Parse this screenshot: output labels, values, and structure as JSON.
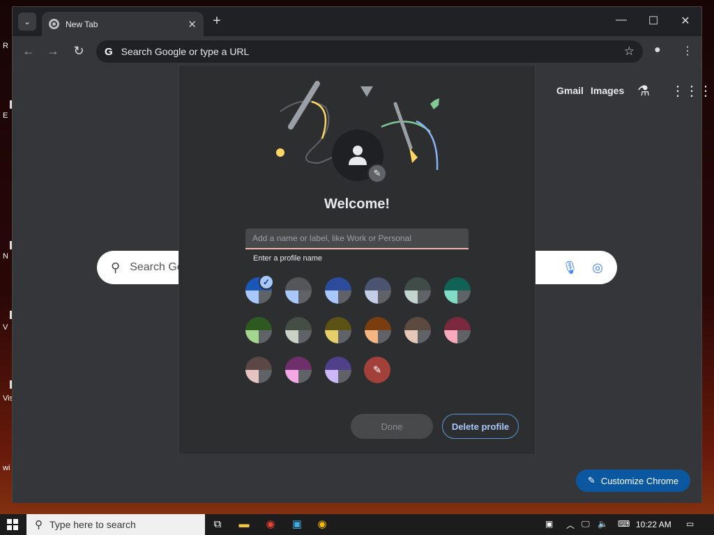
{
  "desktop": {
    "labels": [
      "R",
      "E",
      "N",
      "V",
      "Vis",
      "wi"
    ]
  },
  "browser": {
    "tab_title": "New Tab",
    "omnibox_placeholder": "Search Google or type a URL",
    "ntp": {
      "gmail": "Gmail",
      "images": "Images",
      "search_placeholder": "Search Go",
      "customize_label": "Customize Chrome"
    }
  },
  "dialog": {
    "title": "Welcome!",
    "name_placeholder": "Add a name or label, like Work or Personal",
    "helper_text": "Enter a profile name",
    "done_label": "Done",
    "delete_label": "Delete profile",
    "selected_swatch": 0,
    "swatches": [
      [
        "#1a55b8",
        "#1a55b8",
        "#a8c7fa",
        "#5f6368"
      ],
      [
        "#555659",
        "#555659",
        "#a8c7fa",
        "#5f6368"
      ],
      [
        "#2a4c9a",
        "#2a4c9a",
        "#a8c7fa",
        "#5f6368"
      ],
      [
        "#4a5470",
        "#4a5470",
        "#c5cee6",
        "#5f6368"
      ],
      [
        "#3f4c48",
        "#3f4c48",
        "#c4d4cf",
        "#5f6368"
      ],
      [
        "#0f6255",
        "#0f6255",
        "#80dcc4",
        "#5f6368"
      ],
      [
        "#2e5a22",
        "#2e5a22",
        "#a5d68f",
        "#5f6368"
      ],
      [
        "#454e45",
        "#454e45",
        "#c9d2c6",
        "#5f6368"
      ],
      [
        "#5c5216",
        "#5c5216",
        "#e6cf6a",
        "#5f6368"
      ],
      [
        "#7a3d10",
        "#7a3d10",
        "#f6b682",
        "#5f6368"
      ],
      [
        "#5c4a40",
        "#5c4a40",
        "#e6c8b8",
        "#5f6368"
      ],
      [
        "#7a2a3c",
        "#7a2a3c",
        "#f8a9bc",
        "#5f6368"
      ],
      [
        "#5a4746",
        "#5a4746",
        "#e6c4c2",
        "#5f6368"
      ],
      [
        "#6f2f6a",
        "#6f2f6a",
        "#f4a9e6",
        "#5f6368"
      ],
      [
        "#50408a",
        "#50408a",
        "#cbb8f8",
        "#5f6368"
      ]
    ]
  },
  "taskbar": {
    "search_placeholder": "Type here to search",
    "time": "10:22 AM"
  }
}
